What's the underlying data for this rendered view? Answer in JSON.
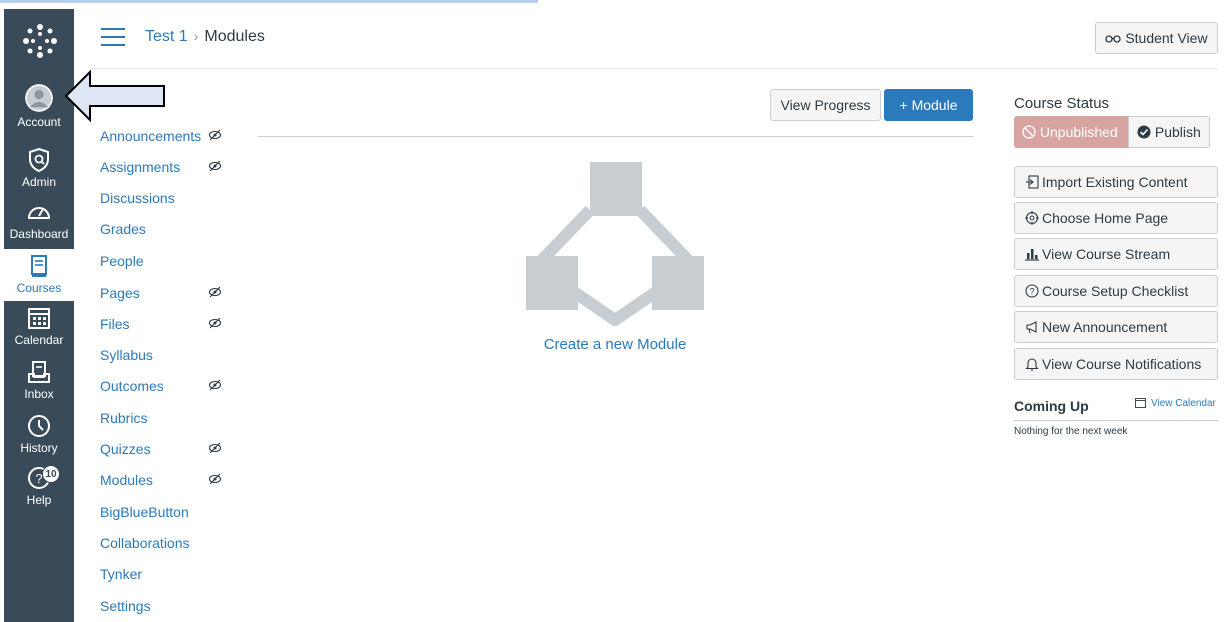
{
  "global_nav": {
    "items": [
      {
        "label": "Account",
        "icon": "account-avatar-icon"
      },
      {
        "label": "Admin",
        "icon": "admin-shield-icon"
      },
      {
        "label": "Dashboard",
        "icon": "dashboard-gauge-icon"
      },
      {
        "label": "Courses",
        "icon": "courses-book-icon",
        "active": true
      },
      {
        "label": "Calendar",
        "icon": "calendar-icon"
      },
      {
        "label": "Inbox",
        "icon": "inbox-icon"
      },
      {
        "label": "History",
        "icon": "history-clock-icon"
      },
      {
        "label": "Help",
        "icon": "help-icon",
        "badge": "10"
      }
    ]
  },
  "breadcrumb": {
    "course": "Test 1",
    "separator": "›",
    "current": "Modules"
  },
  "header": {
    "student_view_label": "Student View"
  },
  "course_nav": {
    "items": [
      {
        "label": "Announcements",
        "hidden": true
      },
      {
        "label": "Assignments",
        "hidden": true
      },
      {
        "label": "Discussions",
        "hidden": false
      },
      {
        "label": "Grades",
        "hidden": false
      },
      {
        "label": "People",
        "hidden": false
      },
      {
        "label": "Pages",
        "hidden": true
      },
      {
        "label": "Files",
        "hidden": true
      },
      {
        "label": "Syllabus",
        "hidden": false
      },
      {
        "label": "Outcomes",
        "hidden": true
      },
      {
        "label": "Rubrics",
        "hidden": false
      },
      {
        "label": "Quizzes",
        "hidden": true
      },
      {
        "label": "Modules",
        "hidden": true
      },
      {
        "label": "BigBlueButton",
        "hidden": false
      },
      {
        "label": "Collaborations",
        "hidden": false
      },
      {
        "label": "Tynker",
        "hidden": false
      },
      {
        "label": "Settings",
        "hidden": false
      }
    ]
  },
  "toolbar": {
    "view_progress_label": "View Progress",
    "add_module_label": "+ Module"
  },
  "empty_state": {
    "create_label": "Create a new Module"
  },
  "sidebar": {
    "course_status_title": "Course Status",
    "unpublished_label": "Unpublished",
    "publish_label": "Publish",
    "buttons": [
      {
        "label": "Import Existing Content",
        "icon": "import-icon"
      },
      {
        "label": "Choose Home Page",
        "icon": "target-icon"
      },
      {
        "label": "View Course Stream",
        "icon": "bar-chart-icon"
      },
      {
        "label": "Course Setup Checklist",
        "icon": "question-circle-icon"
      },
      {
        "label": "New Announcement",
        "icon": "megaphone-icon"
      },
      {
        "label": "View Course Notifications",
        "icon": "bell-icon"
      }
    ],
    "coming_up_title": "Coming Up",
    "view_calendar_label": "View Calendar",
    "nothing_label": "Nothing for the next week"
  },
  "colors": {
    "nav_bg": "#394b58",
    "link": "#2b7abc",
    "primary_button": "#2b7abc",
    "unpublished_bg": "#d8a4a2"
  }
}
